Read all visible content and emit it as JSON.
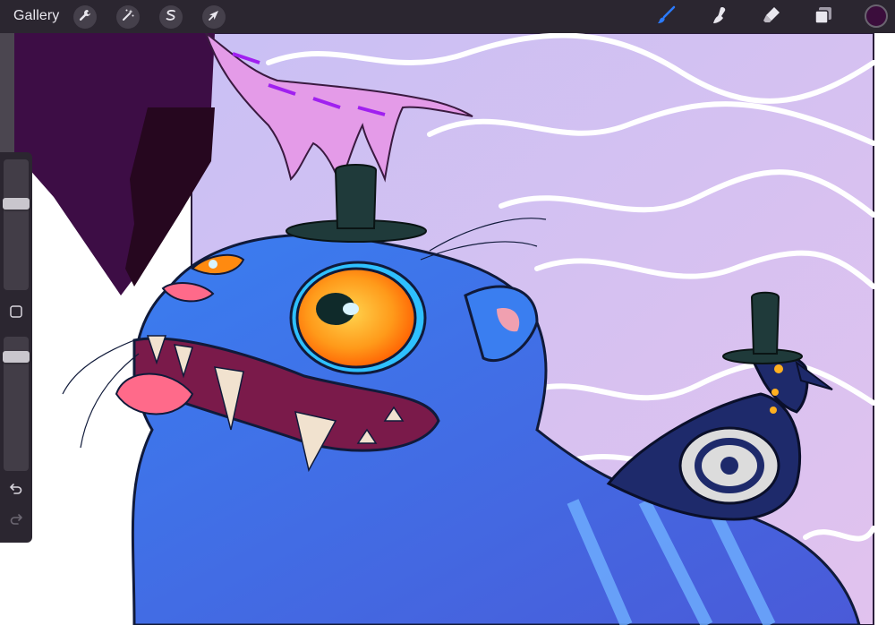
{
  "toolbar": {
    "gallery_label": "Gallery",
    "left_tools": [
      {
        "name": "actions",
        "icon": "wrench-icon"
      },
      {
        "name": "adjustments",
        "icon": "magic-wand-icon"
      },
      {
        "name": "selection",
        "icon": "selection-s-icon"
      },
      {
        "name": "transform",
        "icon": "arrow-cursor-icon"
      }
    ],
    "right_tools": [
      {
        "name": "brush",
        "icon": "brush-icon",
        "active": true
      },
      {
        "name": "smudge",
        "icon": "smudge-finger-icon"
      },
      {
        "name": "eraser",
        "icon": "eraser-icon"
      },
      {
        "name": "layers",
        "icon": "layers-icon"
      }
    ],
    "active_color": "#3b0d3c"
  },
  "sidebar": {
    "brush_size_level": 0.32,
    "opacity_level": 0.12,
    "modify_button": "square-modify-icon",
    "undo": "undo-icon",
    "redo": "redo-icon"
  },
  "artwork": {
    "palette": {
      "background_lavender": "#d9bdf2",
      "cat_blue": "#3f6fe0",
      "eye_orange": "#ff9a1a",
      "hat_dark_teal": "#1f3a3a",
      "hand_pink": "#e49be8",
      "magpie_navy": "#1e2a6b",
      "shadow_purple": "#3d0d45",
      "accent_blue_active": "#2b7bff"
    }
  }
}
